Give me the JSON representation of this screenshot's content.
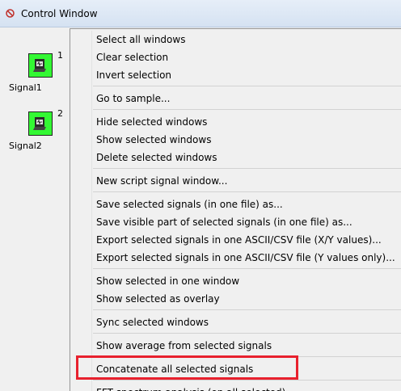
{
  "window": {
    "title": "Control Window",
    "title_icon": "no-entry-icon"
  },
  "signals": [
    {
      "number": "1",
      "label": "Signal1",
      "icon": "signal-file-icon"
    },
    {
      "number": "2",
      "label": "Signal2",
      "icon": "signal-file-icon"
    }
  ],
  "menu": {
    "items": [
      "Select all windows",
      "Clear selection",
      "Invert selection",
      "Go to sample...",
      "Hide selected windows",
      "Show selected windows",
      "Delete selected windows",
      "New script signal window...",
      "Save selected signals (in one file) as...",
      "Save visible part of selected signals (in one file) as...",
      "Export selected signals in one ASCII/CSV file (X/Y values)...",
      "Export selected signals in one ASCII/CSV file (Y values only)...",
      "Show selected in one window",
      "Show selected as overlay",
      "Sync selected windows",
      "Show average from selected signals",
      "Concatenate all selected signals",
      "FFT spectrum analysis (on all selected)"
    ]
  },
  "colors": {
    "signal_icon": "#33f833",
    "highlight_box": "#e8212e"
  }
}
